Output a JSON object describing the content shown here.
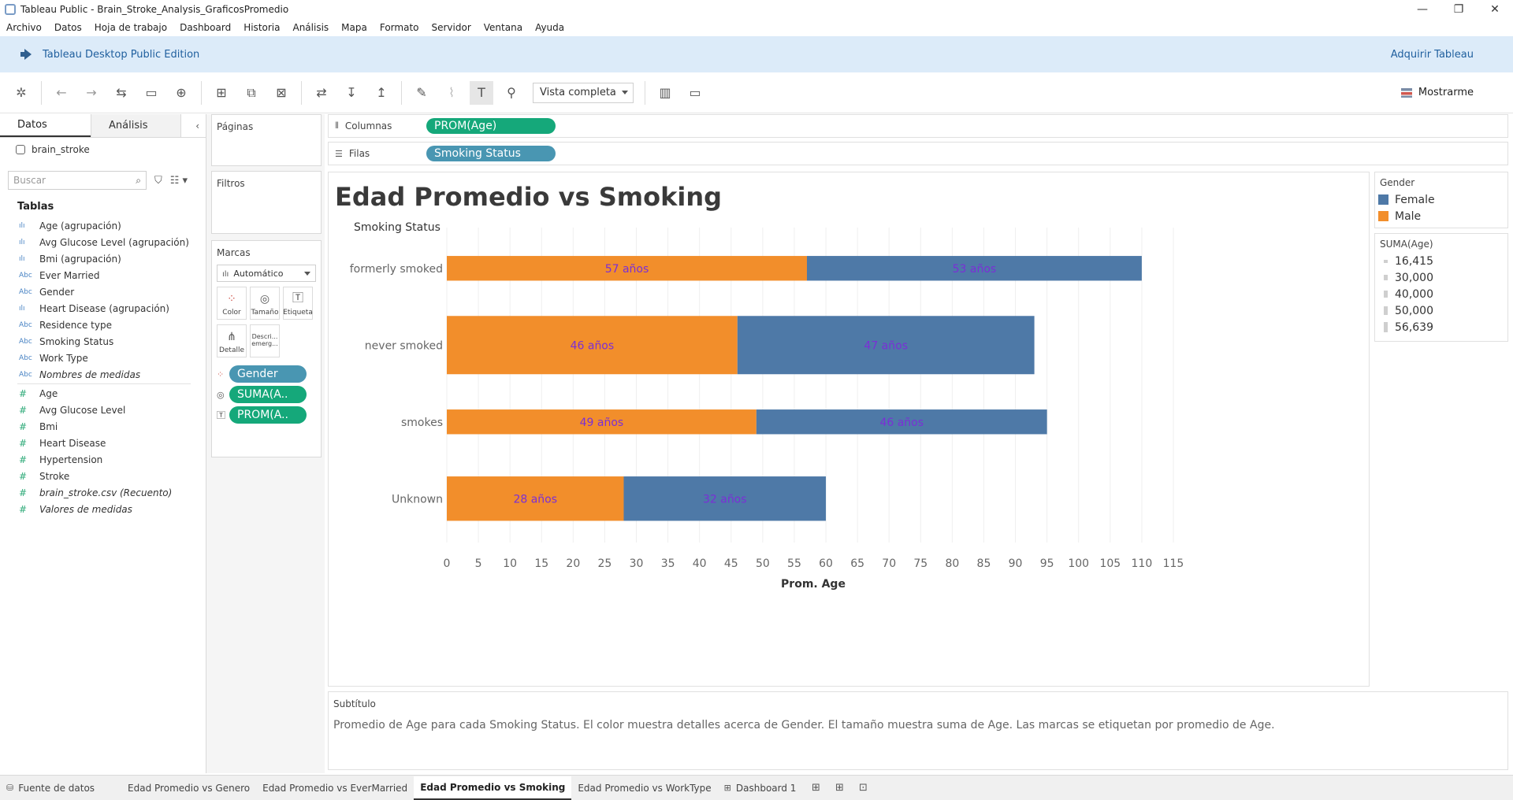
{
  "window": {
    "title": "Tableau Public - Brain_Stroke_Analysis_GraficosPromedio",
    "controls": [
      "—",
      "❐",
      "✕"
    ]
  },
  "menu": [
    "Archivo",
    "Datos",
    "Hoja de trabajo",
    "Dashboard",
    "Historia",
    "Análisis",
    "Mapa",
    "Formato",
    "Servidor",
    "Ventana",
    "Ayuda"
  ],
  "banner": {
    "edition": "Tableau Desktop Public Edition",
    "acquire": "Adquirir Tableau"
  },
  "toolbar": {
    "fit_mode": "Vista completa",
    "show_me": "Mostrarme"
  },
  "data_pane": {
    "tabs": [
      "Datos",
      "Análisis"
    ],
    "source": "brain_stroke",
    "search_placeholder": "Buscar",
    "tables_heading": "Tablas",
    "dimensions": [
      {
        "type": "bin",
        "label": "Age (agrupación)"
      },
      {
        "type": "bin",
        "label": "Avg Glucose Level (agrupación)"
      },
      {
        "type": "bin",
        "label": "Bmi (agrupación)"
      },
      {
        "type": "abc",
        "label": "Ever Married"
      },
      {
        "type": "abc",
        "label": "Gender"
      },
      {
        "type": "bin",
        "label": "Heart Disease (agrupación)"
      },
      {
        "type": "abc",
        "label": "Residence type"
      },
      {
        "type": "abc",
        "label": "Smoking Status"
      },
      {
        "type": "abc",
        "label": "Work Type"
      },
      {
        "type": "abc",
        "label": "Nombres de medidas",
        "italic": true
      }
    ],
    "measures": [
      {
        "label": "Age"
      },
      {
        "label": "Avg Glucose Level"
      },
      {
        "label": "Bmi"
      },
      {
        "label": "Heart Disease"
      },
      {
        "label": "Hypertension"
      },
      {
        "label": "Stroke"
      },
      {
        "label": "brain_stroke.csv (Recuento)",
        "italic": true
      },
      {
        "label": "Valores de medidas",
        "italic": true
      }
    ]
  },
  "cards": {
    "pages": "Páginas",
    "filters": "Filtros",
    "marks": "Marcas",
    "mark_type": "Automático",
    "mark_buttons": [
      "Color",
      "Tamaño",
      "Etiqueta",
      "Detalle",
      "Descri... emerg..."
    ],
    "mark_pills": [
      "Gender",
      "SUMA(A..",
      "PROM(A.."
    ]
  },
  "shelves": {
    "columns_label": "Columnas",
    "columns_pill": "PROM(Age)",
    "rows_label": "Filas",
    "rows_pill": "Smoking Status"
  },
  "worksheet": {
    "title": "Edad Promedio  vs Smoking",
    "row_header": "Smoking Status"
  },
  "chart_data": {
    "type": "bar",
    "orientation": "horizontal stacked",
    "categories": [
      "formerly smoked",
      "never smoked",
      "smokes",
      "Unknown"
    ],
    "series": [
      {
        "name": "Male",
        "color": "#f28e2b",
        "values": [
          57,
          46,
          49,
          28
        ],
        "labels": [
          "57 años",
          "46 años",
          "49 años",
          "28 años"
        ]
      },
      {
        "name": "Female",
        "color": "#4e79a7",
        "values": [
          53,
          47,
          46,
          32
        ],
        "labels": [
          "53 años",
          "47 años",
          "46 años",
          "32 años"
        ]
      }
    ],
    "bar_size_sum_age": {
      "formerly smoked": [
        16415,
        16415
      ],
      "never smoked": [
        56639,
        56639
      ],
      "smokes": [
        16415,
        16415
      ],
      "Unknown": [
        40000,
        40000
      ]
    },
    "xlabel": "Prom. Age",
    "xlim": [
      0,
      116
    ],
    "xticks": [
      0,
      5,
      10,
      15,
      20,
      25,
      30,
      35,
      40,
      45,
      50,
      55,
      60,
      65,
      70,
      75,
      80,
      85,
      90,
      95,
      100,
      105,
      110,
      115
    ],
    "label_color": "#7b2fd6",
    "grid": true
  },
  "legends": {
    "color_title": "Gender",
    "color_items": [
      {
        "label": "Female",
        "color": "#4e79a7"
      },
      {
        "label": "Male",
        "color": "#f28e2b"
      }
    ],
    "size_title": "SUMA(Age)",
    "size_items": [
      {
        "label": "16,415",
        "level": 0.28
      },
      {
        "label": "30,000",
        "level": 0.42
      },
      {
        "label": "40,000",
        "level": 0.56
      },
      {
        "label": "50,000",
        "level": 0.7
      },
      {
        "label": "56,639",
        "level": 0.8
      }
    ]
  },
  "caption": {
    "heading": "Subtítulo",
    "text": "Promedio de Age para cada Smoking Status.  El color muestra detalles acerca de Gender.  El tamaño muestra suma de Age.  Las marcas se etiquetan por promedio de Age."
  },
  "tabs": {
    "datasource": "Fuente de datos",
    "sheets": [
      "Edad Promedio vs Genero",
      "Edad Promedio vs EverMarried",
      "Edad Promedio  vs Smoking",
      "Edad Promedio vs WorkType",
      "Dashboard 1"
    ],
    "active_index": 2
  }
}
